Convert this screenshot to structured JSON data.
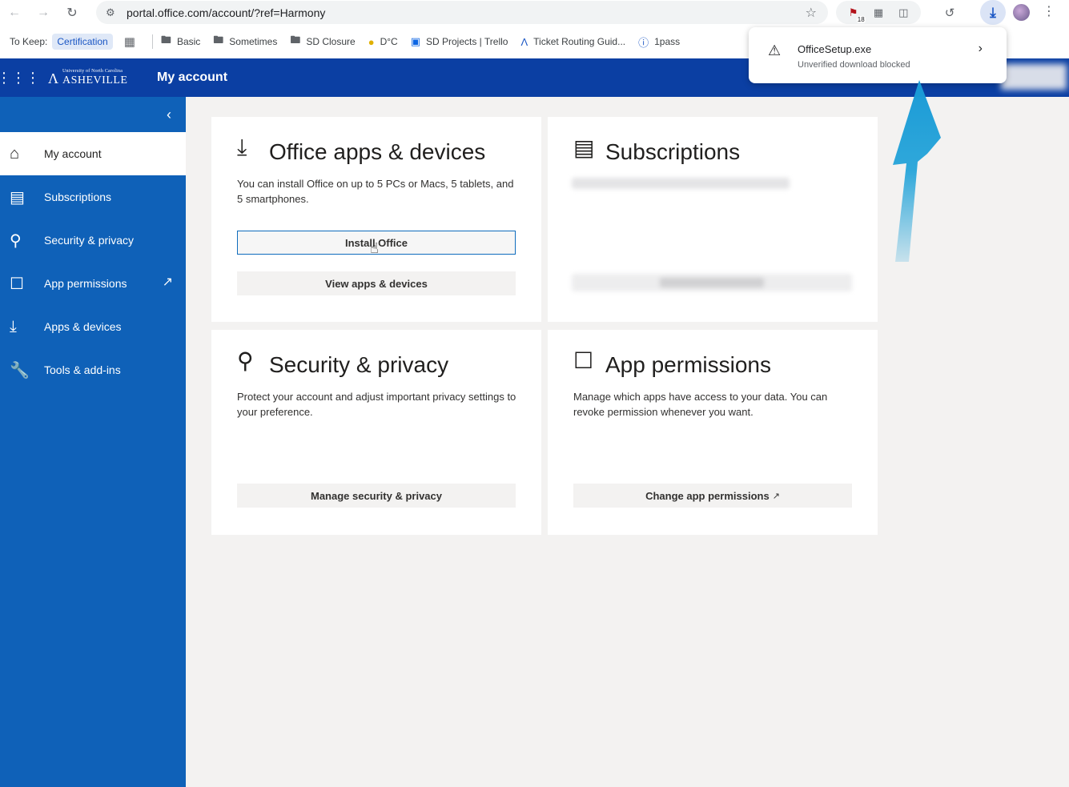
{
  "browser": {
    "url": "portal.office.com/account/?ref=Harmony",
    "extension_badge": "18",
    "bookmarks_label": "To Keep:",
    "bookmarks": [
      {
        "label": "Certification",
        "icon": "chip"
      },
      {
        "label": "",
        "icon": "apps-grid-icon"
      },
      {
        "label": "Basic",
        "icon": "folder-icon"
      },
      {
        "label": "Sometimes",
        "icon": "folder-icon"
      },
      {
        "label": "SD Closure",
        "icon": "folder-icon"
      },
      {
        "label": "D°C",
        "icon": "circle-logo-icon"
      },
      {
        "label": "SD Projects | Trello",
        "icon": "trello-icon"
      },
      {
        "label": "Ticket Routing Guid...",
        "icon": "routing-icon"
      },
      {
        "label": "1pass",
        "icon": "onepassword-icon"
      }
    ]
  },
  "download": {
    "filename": "OfficeSetup.exe",
    "status": "Unverified download blocked"
  },
  "suite": {
    "org_small": "University of North Carolina",
    "org_big": "ASHEVILLE",
    "title": "My account"
  },
  "sidebar": {
    "items": [
      {
        "label": "My account",
        "icon": "home-icon",
        "active": true
      },
      {
        "label": "Subscriptions",
        "icon": "card-icon"
      },
      {
        "label": "Security & privacy",
        "icon": "key-icon"
      },
      {
        "label": "App permissions",
        "icon": "lock-icon"
      },
      {
        "label": "Apps & devices",
        "icon": "download-icon"
      },
      {
        "label": "Tools & add-ins",
        "icon": "wrench-icon"
      }
    ]
  },
  "cards": {
    "office": {
      "title": "Office apps & devices",
      "desc": "You can install Office on up to 5 PCs or Macs, 5 tablets, and 5 smartphones.",
      "install_label": "Install Office",
      "view_label": "View apps & devices"
    },
    "subscriptions": {
      "title": "Subscriptions"
    },
    "security": {
      "title": "Security & privacy",
      "desc": "Protect your account and adjust important privacy settings to your preference.",
      "button_label": "Manage security & privacy"
    },
    "permissions": {
      "title": "App permissions",
      "desc": "Manage which apps have access to your data. You can revoke permission whenever you want.",
      "button_label": "Change app permissions"
    }
  },
  "colors": {
    "suitebar": "#0b3fa3",
    "sidebar": "#0f61b8",
    "annotation_arrow": "#1aa0d8"
  }
}
